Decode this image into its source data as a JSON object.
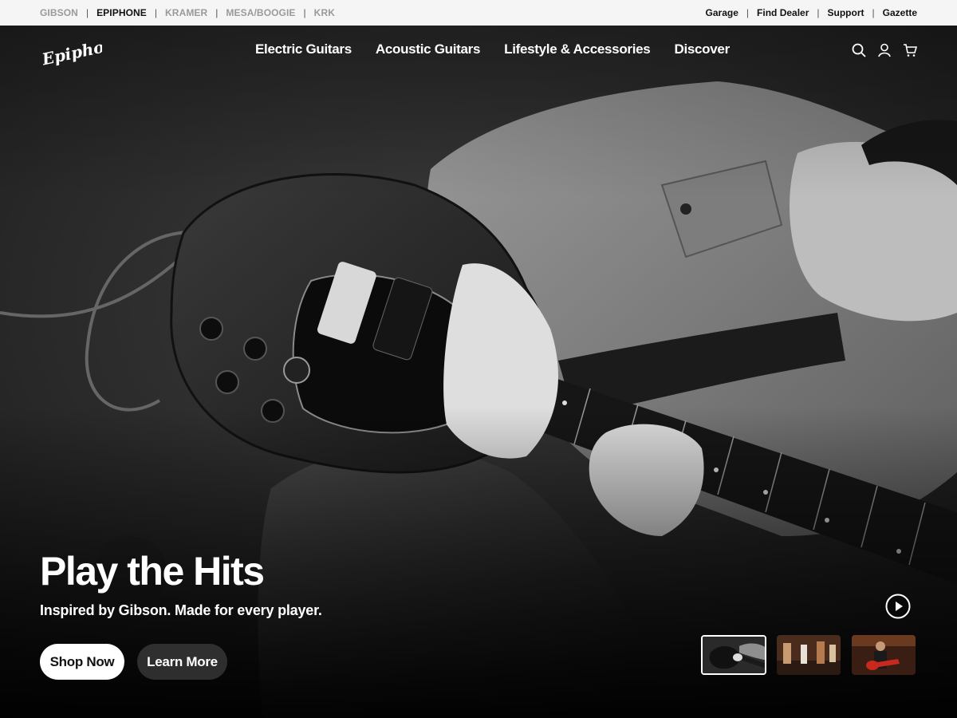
{
  "brand_bar": {
    "brands": [
      {
        "label": "GIBSON",
        "active": false
      },
      {
        "label": "EPIPHONE",
        "active": true
      },
      {
        "label": "KRAMER",
        "active": false
      },
      {
        "label": "MESA/BOOGIE",
        "active": false
      },
      {
        "label": "KRK",
        "active": false
      }
    ],
    "separator": "|",
    "utility_links": [
      "Garage",
      "Find Dealer",
      "Support",
      "Gazette"
    ]
  },
  "header": {
    "logo_text": "Epiphone",
    "nav": [
      "Electric Guitars",
      "Acoustic Guitars",
      "Lifestyle & Accessories",
      "Discover"
    ],
    "icons": [
      "search-icon",
      "account-icon",
      "cart-icon"
    ]
  },
  "hero": {
    "title": "Play the Hits",
    "subtitle": "Inspired by Gibson. Made for every player.",
    "primary_cta": "Shop Now",
    "secondary_cta": "Learn More",
    "play_icon": "play-circle-icon",
    "thumbnails_count": 3,
    "active_thumbnail": 1
  },
  "colors": {
    "brand_bar_bg": "#f5f5f5",
    "active_brand": "#111111",
    "inactive_brand": "#9a9a9a",
    "hero_text": "#ffffff",
    "primary_button_bg": "#ffffff",
    "thumb_accent_red": "#c8281e"
  }
}
